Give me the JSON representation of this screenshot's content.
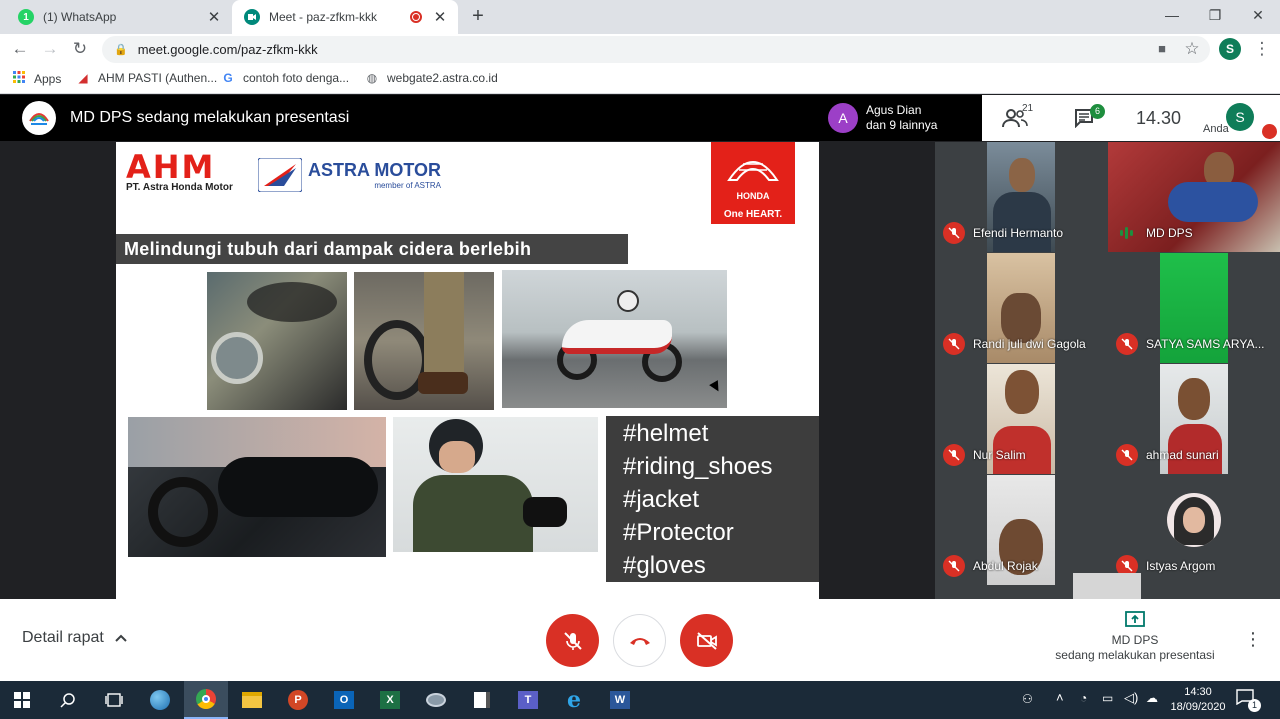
{
  "browser": {
    "tabs": [
      {
        "title": "(1) WhatsApp",
        "badge": "1",
        "active": false
      },
      {
        "title": "Meet - paz-zfkm-kkk",
        "active": true
      }
    ],
    "url": "meet.google.com/paz-zfkm-kkk",
    "profile_initial": "S"
  },
  "bookmarks": [
    {
      "label": "Apps",
      "icon": "apps-grid-icon"
    },
    {
      "label": "AHM PASTI (Authen...",
      "icon": "honda-wing-icon"
    },
    {
      "label": "contoh foto denga...",
      "icon": "google-icon"
    },
    {
      "label": "webgate2.astra.co.id",
      "icon": "globe-icon"
    }
  ],
  "meet": {
    "presentation_banner": "MD DPS sedang melakukan presentasi",
    "presenter": {
      "initial": "A",
      "line1": "Agus Dian",
      "line2": "dan 9 lainnya"
    },
    "participants_count": "21",
    "chat_count": "6",
    "time": "14.30",
    "self": {
      "initial": "S",
      "label": "Anda"
    }
  },
  "slide": {
    "ahm_logo": "AHM",
    "ahm_sub": "PT. Astra Honda Motor",
    "astra_logo": "ASTRA MOTOR",
    "astra_sub": "member of ASTRA",
    "honda_logo": "HONDA",
    "honda_tagline": "One HEART.",
    "title": "Melindungi tubuh dari dampak cidera berlebih",
    "hashtags": [
      "#helmet",
      "#riding_shoes",
      "#jacket",
      "#Protector",
      "#gloves"
    ]
  },
  "participants": [
    {
      "name": "Efendi Hermanto",
      "status": "muted"
    },
    {
      "name": "MD DPS",
      "status": "speaking"
    },
    {
      "name": "Randi juli dwi Gagola",
      "status": "muted"
    },
    {
      "name": "SATYA SAMS ARYA...",
      "status": "muted"
    },
    {
      "name": "Nur Salim",
      "status": "muted"
    },
    {
      "name": "ahmad sunari",
      "status": "muted"
    },
    {
      "name": "Abdul Rojak",
      "status": "muted"
    },
    {
      "name": "Istyas Argom",
      "status": "muted"
    }
  ],
  "bottombar": {
    "details_label": "Detail rapat",
    "presenting_name": "MD DPS",
    "presenting_text": "sedang melakukan presentasi"
  },
  "taskbar": {
    "time": "14:30",
    "date": "18/09/2020",
    "notification_count": "1"
  },
  "colors": {
    "meet_red": "#d93025",
    "speaking_green": "#1e8e3e",
    "taskbar": "#1b2a38"
  }
}
